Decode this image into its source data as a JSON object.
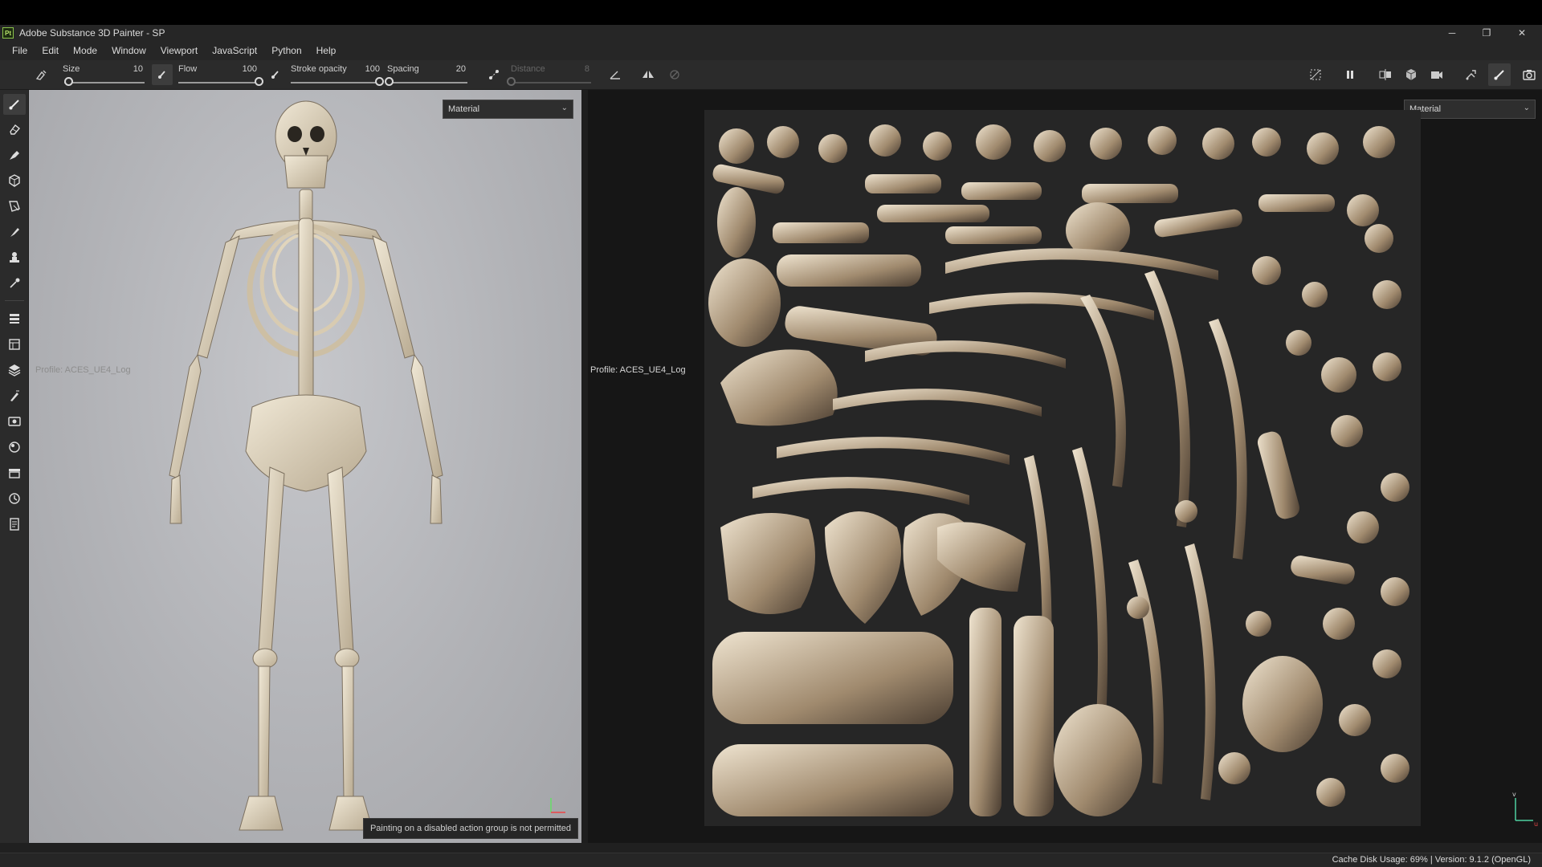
{
  "app": {
    "title": "Adobe Substance 3D Painter - SP",
    "logo_text": "Pt",
    "accent": "#8bc34a"
  },
  "window_controls": {
    "minimize": "─",
    "restore": "❐",
    "close": "✕"
  },
  "menu": [
    "File",
    "Edit",
    "Mode",
    "Window",
    "Viewport",
    "JavaScript",
    "Python",
    "Help"
  ],
  "toolbar": {
    "size": {
      "label": "Size",
      "value": "10",
      "level": 0.05
    },
    "flow": {
      "label": "Flow",
      "value": "100",
      "level": 1.0
    },
    "stroke_opacity": {
      "label": "Stroke opacity",
      "value": "100",
      "level": 1.0
    },
    "spacing": {
      "label": "Spacing",
      "value": "20",
      "level": 0.02
    },
    "distance": {
      "label": "Distance",
      "value": "8",
      "level": 0.0,
      "disabled": true
    },
    "icons_left": [
      "brush-preset-icon",
      "alpha-icon",
      "color-picker-icon",
      "lazy-mouse-icon",
      "angle-icon",
      "symmetry-icon",
      "eraser-mode-icon"
    ],
    "icons_right": [
      "hide-grid-icon",
      "pause-icon",
      "split-view-icon",
      "cube-view-icon",
      "camera-icon",
      "bake-icon",
      "paint-brush-icon",
      "screenshot-icon"
    ]
  },
  "left_tools": [
    "paint-brush-icon",
    "eraser-icon",
    "projection-icon",
    "geometry-mask-icon",
    "polygon-fill-icon",
    "smudge-icon",
    "clone-icon",
    "color-picker-icon",
    "layers-icon",
    "texture-set-list-icon",
    "texture-set-settings-icon",
    "properties-icon",
    "display-settings-icon",
    "shader-settings-icon",
    "assets-icon",
    "history-icon",
    "log-icon"
  ],
  "viewport_3d": {
    "material_dropdown": "Material",
    "profile": "Profile: ACES_UE4_Log",
    "toast": "Painting on a disabled action group is not permitted",
    "background": "#b6b7bb"
  },
  "viewport_2d": {
    "material_dropdown": "Material",
    "profile": "Profile: ACES_UE4_Log",
    "axis_labels": {
      "v": "v",
      "u": "u"
    }
  },
  "status": {
    "text": "Cache Disk Usage:   69%  |  Version: 9.1.2 (OpenGL)"
  }
}
